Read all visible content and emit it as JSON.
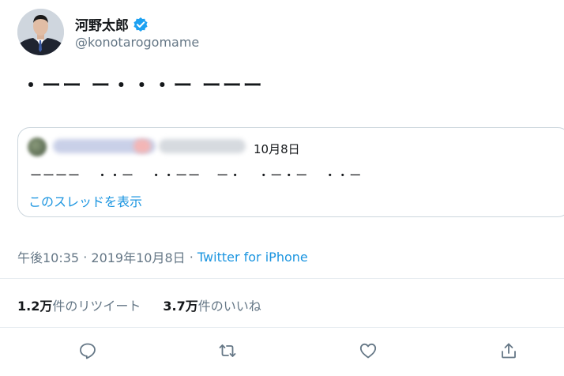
{
  "author": {
    "display_name": "河野太郎",
    "handle": "@konotarogomame",
    "verified": true
  },
  "tweet": {
    "morse_text": "・ーー ー・・・ー ーーー"
  },
  "quoted_tweet": {
    "date": "10月8日",
    "morse_text": "ーーーー  ・・ー  ・・ーー  ー・  ・ー・ー  ・・ー",
    "show_thread_label": "このスレッドを表示"
  },
  "meta": {
    "time": "午後10:35",
    "separator": " · ",
    "date": "2019年10月8日",
    "separator2": " · ",
    "source": "Twitter for iPhone"
  },
  "stats": {
    "retweets_count": "1.2万",
    "retweets_label": "件のリツイート",
    "likes_count": "3.7万",
    "likes_label": "件のいいね"
  },
  "actions": [
    "reply-icon",
    "retweet-icon",
    "like-icon",
    "share-icon"
  ],
  "colors": {
    "accent": "#1b95e0",
    "secondary_text": "#657786",
    "border": "#ccd6dd",
    "verified": "#1da1f2"
  }
}
